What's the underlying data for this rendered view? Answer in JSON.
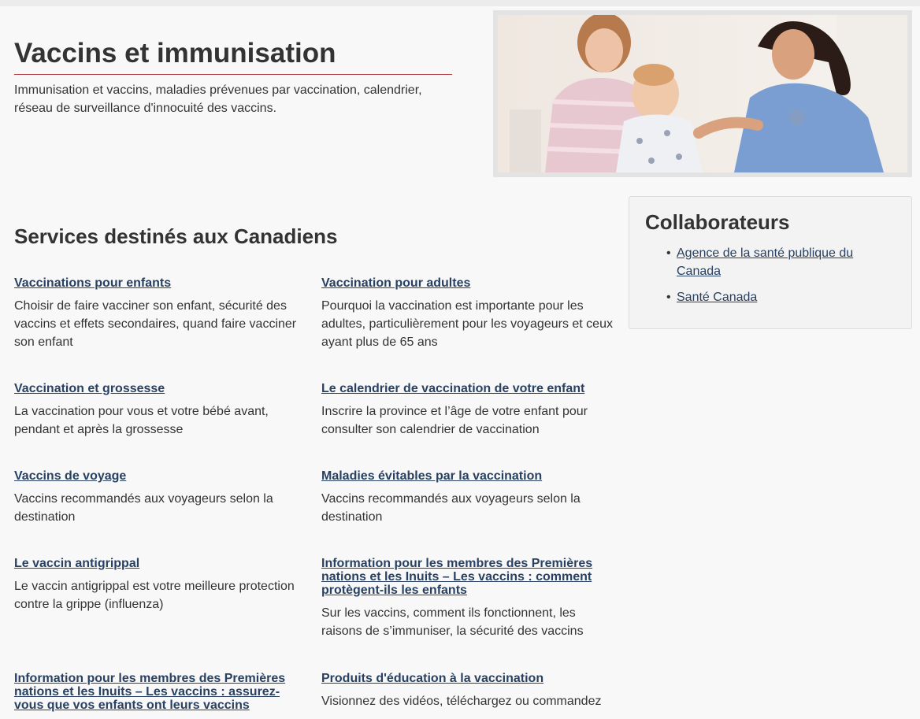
{
  "header": {
    "title": "Vaccins et immunisation",
    "description": "Immunisation et vaccins, maladies prévenues par vaccination, calendrier, réseau de surveillance d'innocuité des vaccins."
  },
  "hero_image": {
    "icon": "mother-baby-nurse-photo"
  },
  "services": {
    "title": "Services destinés aux Canadiens",
    "items": [
      {
        "label": "Vaccinations pour enfants",
        "desc": "Choisir de faire vacciner son enfant, sécurité des vaccins et effets secondaires, quand faire vacciner son enfant"
      },
      {
        "label": "Vaccination pour adultes",
        "desc": "Pourquoi la vaccination est importante pour les adultes, particulièrement pour les voyageurs et ceux ayant plus de 65 ans"
      },
      {
        "label": "Vaccination et grossesse",
        "desc": "La vaccination pour vous et votre bébé avant, pendant et après la grossesse"
      },
      {
        "label": "Le calendrier de vaccination de votre enfant",
        "desc": "Inscrire la province et l’âge de votre enfant pour consulter son calendrier de vaccination"
      },
      {
        "label": "Vaccins de voyage",
        "desc": "Vaccins recommandés aux voyageurs selon la destination"
      },
      {
        "label": "Maladies évitables par la vaccination",
        "desc": "Vaccins recommandés aux voyageurs selon la destination"
      },
      {
        "label": "Le vaccin antigrippal",
        "desc": "Le vaccin antigrippal est votre meilleure protection contre la grippe (influenza)"
      },
      {
        "label": "Information pour les membres des Premières nations et les Inuits – Les vaccins : comment protègent-ils les enfants",
        "desc": "Sur les vaccins, comment ils fonctionnent, les raisons de s’immuniser, la sécurité des vaccins"
      },
      {
        "label": "Information pour les membres des Premières nations et les Inuits – Les vaccins : assurez-vous que vos enfants ont leurs vaccins",
        "desc": ""
      },
      {
        "label": "Produits d'éducation à la vaccination",
        "desc": "Visionnez des vidéos, téléchargez ou commandez"
      }
    ]
  },
  "collaborators": {
    "title": "Collaborateurs",
    "items": [
      {
        "label": "Agence de la santé publique du Canada"
      },
      {
        "label": "Santé Canada"
      }
    ]
  },
  "colors": {
    "background": "#f8f8f8",
    "link": "#284162",
    "text": "#333333",
    "title_rule": "#af3c43"
  }
}
